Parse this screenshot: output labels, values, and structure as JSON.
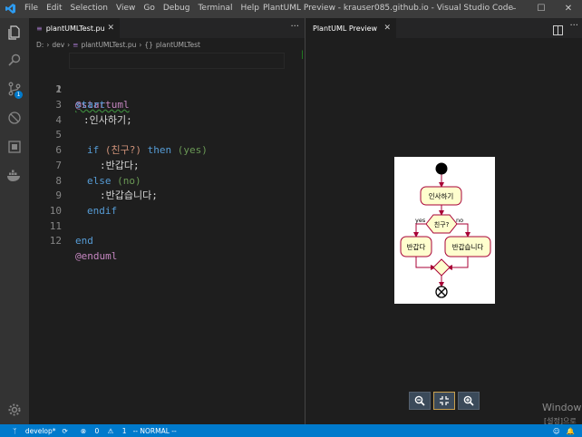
{
  "titlebar": {
    "menu": [
      "File",
      "Edit",
      "Selection",
      "View",
      "Go",
      "Debug",
      "Terminal",
      "Help"
    ],
    "title": "PlantUML Preview - krauser085.github.io - Visual Studio Code"
  },
  "editor": {
    "tab_label": "plantUMLTest.pu",
    "breadcrumb": [
      "D:",
      "dev",
      "plantUMLTest.pu",
      "plantUMLTest"
    ],
    "lines": [
      {
        "n": "1",
        "text": "@startuml"
      },
      {
        "n": "2",
        "text": "start"
      },
      {
        "n": "3",
        "text": ":인사하기;"
      },
      {
        "n": "4",
        "text": ""
      },
      {
        "n": "5",
        "if": "if",
        "cond": "(친구?)",
        "then": "then",
        "yes": "(yes)"
      },
      {
        "n": "6",
        "text": ":반갑다;"
      },
      {
        "n": "7",
        "else": "else",
        "no": "(no)"
      },
      {
        "n": "8",
        "text": ":반갑습니다;"
      },
      {
        "n": "9",
        "text": "endif"
      },
      {
        "n": "10",
        "text": ""
      },
      {
        "n": "11",
        "text": "end"
      },
      {
        "n": "12",
        "text": "@enduml"
      }
    ]
  },
  "preview": {
    "tab_label": "PlantUML Preview",
    "diagram": {
      "nodes": [
        "인사하기",
        "친구?",
        "반갑다",
        "반갑습니다"
      ],
      "yes_label": "yes",
      "no_label": "no"
    }
  },
  "watermark": {
    "line1": "Window",
    "line2": "[설정]으로"
  },
  "statusbar": {
    "branch": "develop*",
    "errors": "0",
    "warnings": "1",
    "mode": "-- NORMAL --"
  },
  "colors": {
    "accent": "#007acc",
    "diagram_node_fill": "#fefece",
    "diagram_border": "#a80036"
  }
}
